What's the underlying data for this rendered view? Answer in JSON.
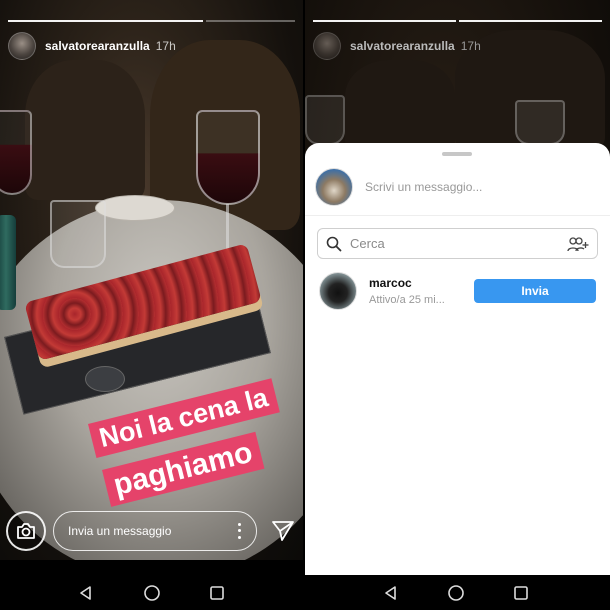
{
  "left_story": {
    "username": "salvatorearanzulla",
    "time": "17h",
    "caption_line1": "Noi la cena la",
    "caption_line2": "paghiamo",
    "reply_placeholder": "Invia un messaggio"
  },
  "right_story": {
    "username": "salvatorearanzulla",
    "time": "17h"
  },
  "share_sheet": {
    "message_placeholder": "Scrivi un messaggio...",
    "search_placeholder": "Cerca",
    "contacts": [
      {
        "name": "marcoc",
        "status": "Attivo/a 25 mi...",
        "action": "Invia"
      }
    ]
  },
  "navbar": {
    "icons": [
      "back-icon",
      "home-icon",
      "recents-icon"
    ]
  },
  "colors": {
    "caption_bg": "#e5436a",
    "send_button": "#3897f0"
  }
}
